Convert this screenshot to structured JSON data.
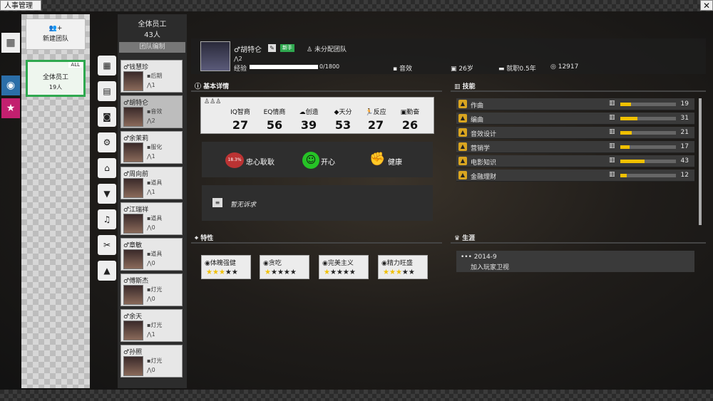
{
  "window": {
    "title": "人事管理",
    "close": "✕"
  },
  "left_rail": [
    {
      "icon": "grid-icon",
      "glyph": "▦"
    },
    {
      "icon": "globe-icon",
      "glyph": "◉"
    },
    {
      "icon": "star-icon",
      "glyph": "★"
    }
  ],
  "teams": {
    "new_team_label": "新建团队",
    "new_team_icon": "👥+",
    "all_badge": "ALL",
    "all_label": "全体员工",
    "all_count": "19人"
  },
  "staff_list": {
    "header": "全体员工",
    "count": "43人",
    "edit_button": "团队编制",
    "employees": [
      {
        "name": "钱慧珍",
        "role": "后期",
        "level": "1"
      },
      {
        "name": "胡特仑",
        "role": "音效",
        "level": "2"
      },
      {
        "name": "余茉莉",
        "role": "服化",
        "level": "1"
      },
      {
        "name": "周向前",
        "role": "道具",
        "level": "1"
      },
      {
        "name": "江瑞祥",
        "role": "道具",
        "level": "0"
      },
      {
        "name": "章敏",
        "role": "道具",
        "level": "0"
      },
      {
        "name": "傅斯杰",
        "role": "灯光",
        "level": "0"
      },
      {
        "name": "余天",
        "role": "灯光",
        "level": "1"
      },
      {
        "name": "孙照",
        "role": "灯光",
        "level": "0"
      }
    ]
  },
  "category_tabs": [
    {
      "icon": "grid-icon",
      "glyph": "▦"
    },
    {
      "icon": "book-icon",
      "glyph": "▤"
    },
    {
      "icon": "camera-icon",
      "glyph": "◙"
    },
    {
      "icon": "projector-icon",
      "glyph": "⚙"
    },
    {
      "icon": "store-icon",
      "glyph": "⌂"
    },
    {
      "icon": "shirt-icon",
      "glyph": "▼"
    },
    {
      "icon": "music-icon",
      "glyph": "♫"
    },
    {
      "icon": "scissors-icon",
      "glyph": "✂"
    },
    {
      "icon": "graduation-icon",
      "glyph": "▲"
    }
  ],
  "profile": {
    "name": "胡特仑",
    "badge": "新手",
    "team": "未分配团队",
    "level": "2",
    "exp_label": "经验",
    "exp_value": "0/1800",
    "exp_fraction": 0.0,
    "role": "音效",
    "age": "26岁",
    "tenure": "就职0.5年",
    "salary": "12917"
  },
  "basic": {
    "title": "基本详情",
    "stats": [
      {
        "label": "智商",
        "value": "27",
        "icon": "IQ"
      },
      {
        "label": "情商",
        "value": "56",
        "icon": "EQ"
      },
      {
        "label": "创造",
        "value": "39",
        "icon": "☁"
      },
      {
        "label": "天分",
        "value": "53",
        "icon": "◆"
      },
      {
        "label": "反应",
        "value": "27",
        "icon": "🏃"
      },
      {
        "label": "勤奋",
        "value": "26",
        "icon": "▣"
      }
    ],
    "loyalty_pct": "18.3%",
    "loyalty": "忠心耿耿",
    "mood": "开心",
    "health": "健康",
    "complaint": "暂无诉求"
  },
  "skills": {
    "title": "技能",
    "items": [
      {
        "name": "作曲",
        "value": "19",
        "fraction": 0.19
      },
      {
        "name": "编曲",
        "value": "31",
        "fraction": 0.31
      },
      {
        "name": "音效设计",
        "value": "21",
        "fraction": 0.21
      },
      {
        "name": "营销学",
        "value": "17",
        "fraction": 0.17
      },
      {
        "name": "电影知识",
        "value": "43",
        "fraction": 0.43
      },
      {
        "name": "金融理财",
        "value": "12",
        "fraction": 0.12
      }
    ]
  },
  "traits": {
    "title": "特性",
    "items": [
      {
        "name": "体魄强健",
        "stars": "★★★★★",
        "filled": 3
      },
      {
        "name": "贪吃",
        "stars": "★★★★★",
        "filled": 1
      },
      {
        "name": "完美主义",
        "stars": "★★★★★",
        "filled": 1
      },
      {
        "name": "精力旺盛",
        "stars": "★★★★★",
        "filled": 3
      }
    ]
  },
  "career": {
    "title": "生涯",
    "entries": [
      {
        "date": "2014-9",
        "text": "加入玩家卫视"
      }
    ]
  },
  "colors": {
    "accent_green": "#2fa84f",
    "star": "#f0c000",
    "skill_icon": "#d9a520"
  }
}
